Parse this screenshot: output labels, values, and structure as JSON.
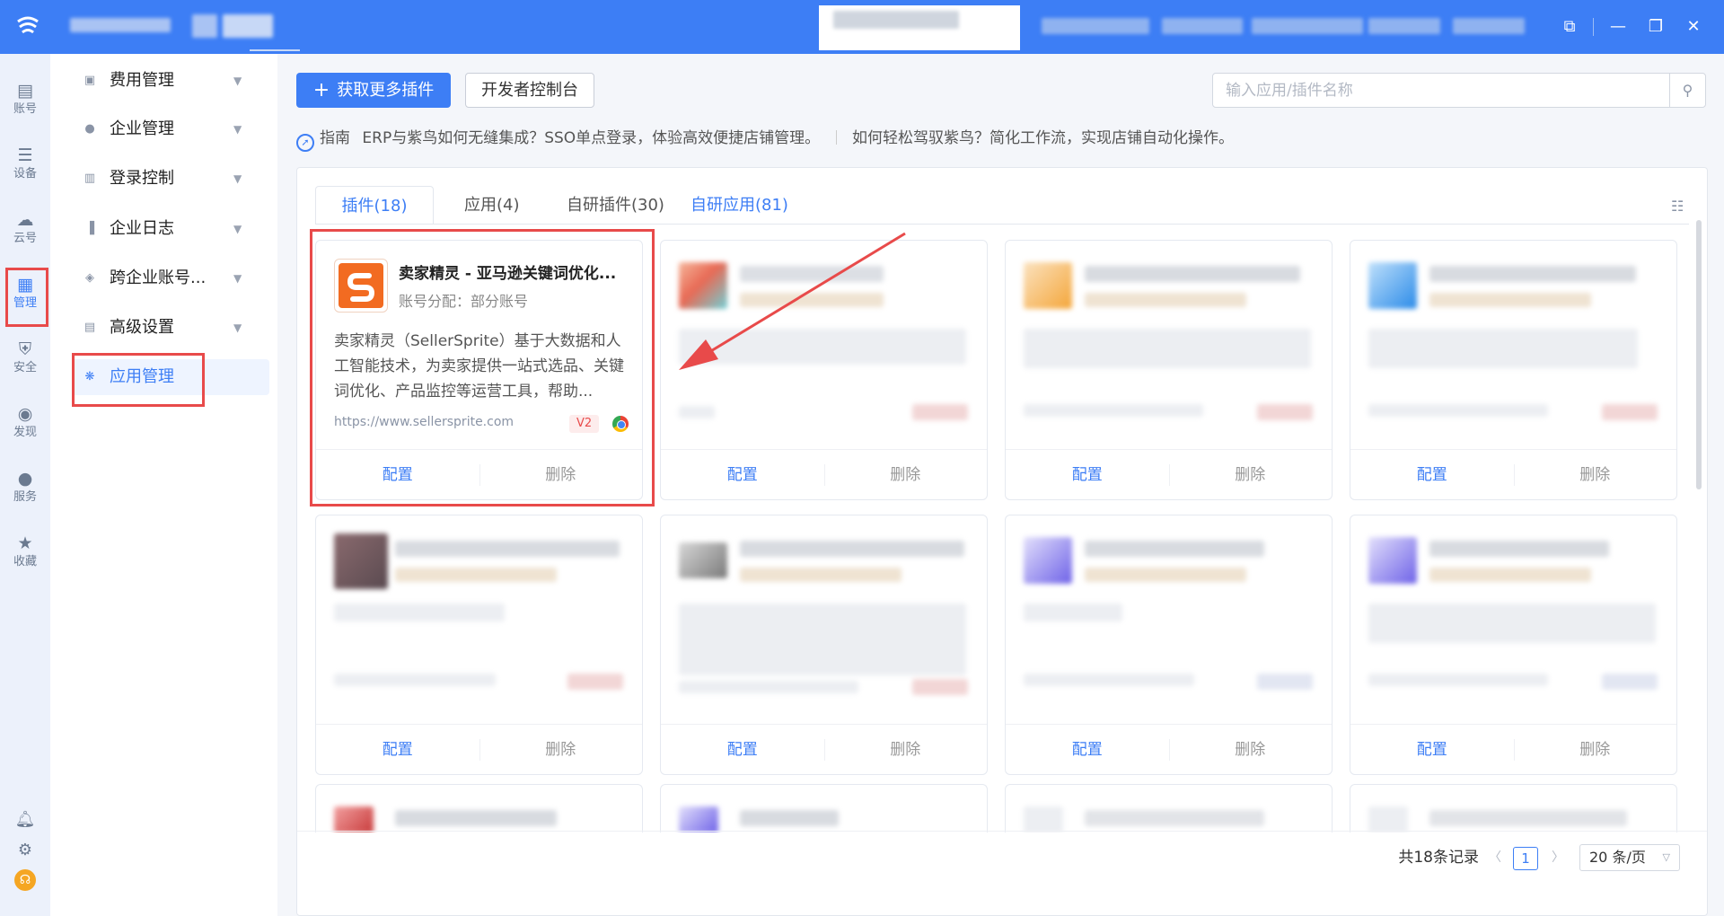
{
  "rail": {
    "items": [
      {
        "label": "账号",
        "icon": "store-icon"
      },
      {
        "label": "设备",
        "icon": "device-icon"
      },
      {
        "label": "云号",
        "icon": "cloud-icon"
      },
      {
        "label": "管理",
        "icon": "manage-icon"
      },
      {
        "label": "安全",
        "icon": "security-icon"
      },
      {
        "label": "发现",
        "icon": "compass-icon"
      },
      {
        "label": "服务",
        "icon": "service-icon"
      },
      {
        "label": "收藏",
        "icon": "star-icon"
      }
    ],
    "active_index": 3
  },
  "submenu": {
    "items": [
      {
        "label": "费用管理",
        "icon": "fee-icon",
        "expandable": true
      },
      {
        "label": "企业管理",
        "icon": "enterprise-icon",
        "expandable": true
      },
      {
        "label": "登录控制",
        "icon": "login-control-icon",
        "expandable": true
      },
      {
        "label": "企业日志",
        "icon": "log-icon",
        "expandable": true
      },
      {
        "label": "跨企业账号...",
        "icon": "cross-account-icon",
        "expandable": true
      },
      {
        "label": "高级设置",
        "icon": "advanced-settings-icon",
        "expandable": true
      },
      {
        "label": "应用管理",
        "icon": "app-manage-icon",
        "expandable": false
      }
    ],
    "active_index": 6
  },
  "toolbar": {
    "primary_label": "获取更多插件",
    "secondary_label": "开发者控制台",
    "search_placeholder": "输入应用/插件名称"
  },
  "guide": {
    "label": "指南",
    "link1": "ERP与紫鸟如何无缝集成？SSO单点登录，体验高效便捷店铺管理。",
    "link2": "如何轻松驾驭紫鸟？简化工作流，实现店铺自动化操作。"
  },
  "tabs": [
    {
      "label": "插件(18)"
    },
    {
      "label": "应用(4)"
    },
    {
      "label": "自研插件(30)"
    },
    {
      "label": "自研应用(81)"
    }
  ],
  "active_tab": 0,
  "featured_card": {
    "title": "卖家精灵 - 亚马逊关键词优化...",
    "assignment": "账号分配：部分账号",
    "description": "卖家精灵（SellerSprite）基于大数据和人工智能技术，为卖家提供一站式选品、关键词优化、产品监控等运营工具，帮助...",
    "url": "https://www.sellersprite.com",
    "version": "V2"
  },
  "card_actions": {
    "configure": "配置",
    "delete": "删除"
  },
  "pagination": {
    "total": "共18条记录",
    "current_page": "1",
    "page_size": "20 条/页"
  },
  "colors": {
    "brand": "#3d7ef5",
    "highlight": "#e84a4a"
  }
}
